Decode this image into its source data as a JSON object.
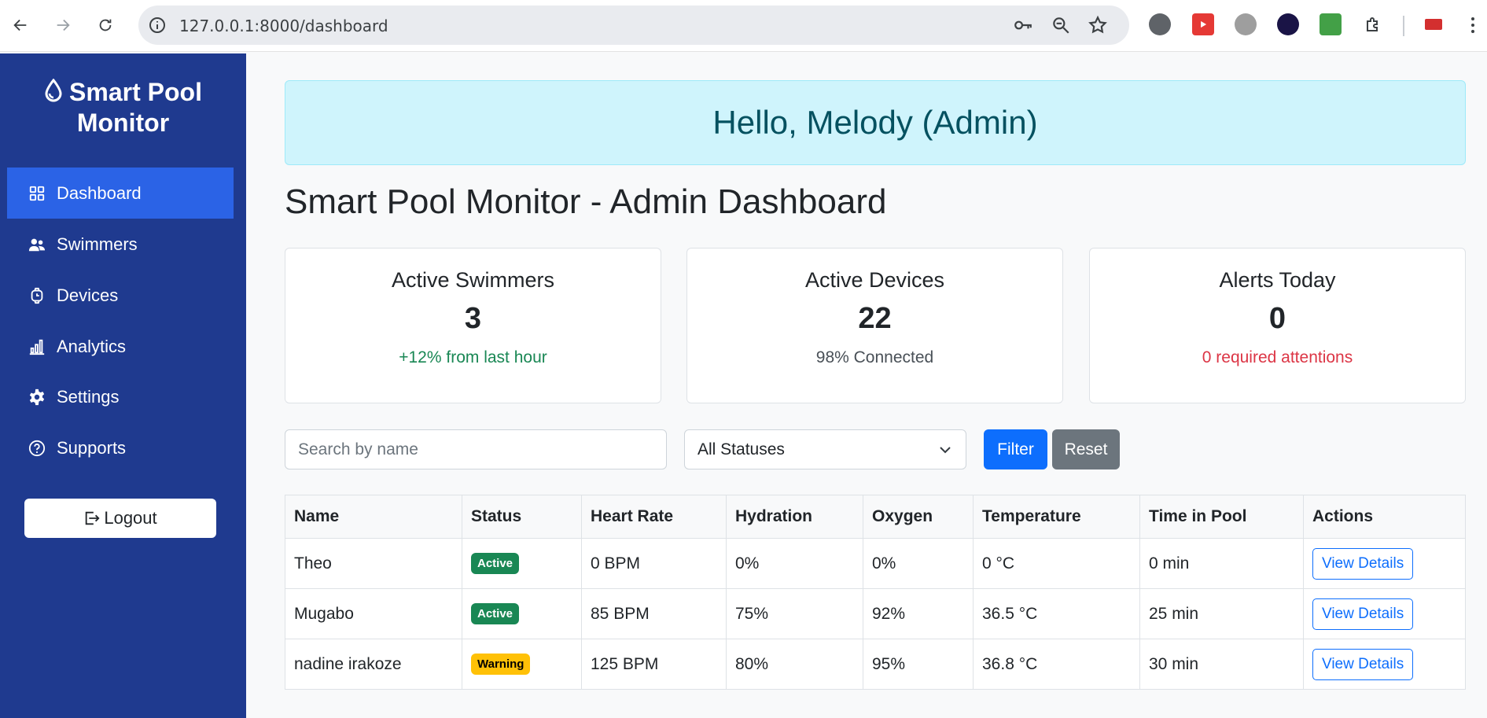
{
  "browser": {
    "url": "127.0.0.1:8000/dashboard"
  },
  "sidebar": {
    "brand_line1": "Smart Pool",
    "brand_line2": "Monitor",
    "items": [
      {
        "label": "Dashboard",
        "icon": "grid-icon",
        "active": true
      },
      {
        "label": "Swimmers",
        "icon": "people-icon",
        "active": false
      },
      {
        "label": "Devices",
        "icon": "watch-icon",
        "active": false
      },
      {
        "label": "Analytics",
        "icon": "bar-chart-icon",
        "active": false
      },
      {
        "label": "Settings",
        "icon": "gear-icon",
        "active": false
      },
      {
        "label": "Supports",
        "icon": "question-circle-icon",
        "active": false
      }
    ],
    "logout_label": "Logout"
  },
  "greeting": "Hello, Melody (Admin)",
  "page_title": "Smart Pool Monitor - Admin Dashboard",
  "cards": [
    {
      "title": "Active Swimmers",
      "value": "3",
      "sub": "+12% from last hour",
      "sub_color": "#198754"
    },
    {
      "title": "Active Devices",
      "value": "22",
      "sub": "98% Connected",
      "sub_color": "#495057"
    },
    {
      "title": "Alerts Today",
      "value": "0",
      "sub": "0 required attentions",
      "sub_color": "#dc3545"
    }
  ],
  "filters": {
    "search_placeholder": "Search by name",
    "status_selected": "All Statuses",
    "filter_label": "Filter",
    "reset_label": "Reset"
  },
  "table": {
    "headers": [
      "Name",
      "Status",
      "Heart Rate",
      "Hydration",
      "Oxygen",
      "Temperature",
      "Time in Pool",
      "Actions"
    ],
    "rows": [
      {
        "name": "Theo",
        "status": "Active",
        "status_type": "active",
        "heart_rate": "0 BPM",
        "hydration": "0%",
        "oxygen": "0%",
        "temperature": "0 °C",
        "time": "0 min",
        "action": "View Details"
      },
      {
        "name": "Mugabo",
        "status": "Active",
        "status_type": "active",
        "heart_rate": "85 BPM",
        "hydration": "75%",
        "oxygen": "92%",
        "temperature": "36.5 °C",
        "time": "25 min",
        "action": "View Details"
      },
      {
        "name": "nadine irakoze",
        "status": "Warning",
        "status_type": "warning",
        "heart_rate": "125 BPM",
        "hydration": "80%",
        "oxygen": "95%",
        "temperature": "36.8 °C",
        "time": "30 min",
        "action": "View Details"
      }
    ]
  },
  "colors": {
    "sidebar_bg": "#1f3a8f",
    "sidebar_active": "#2b63e6",
    "primary": "#0d6efd",
    "secondary": "#6c757d"
  }
}
